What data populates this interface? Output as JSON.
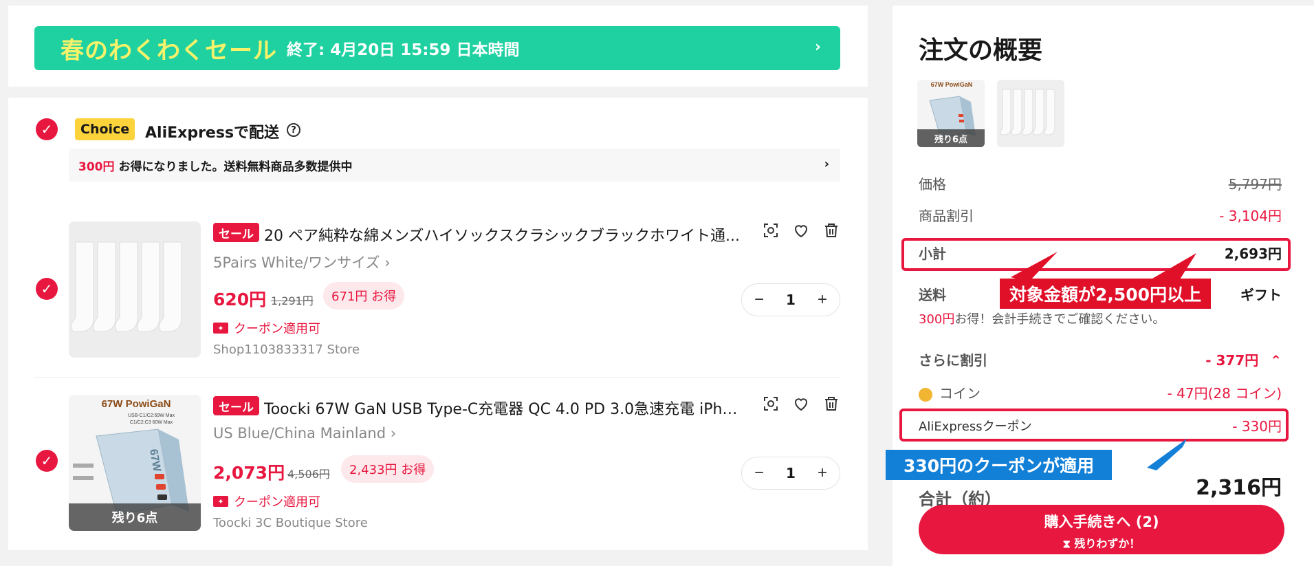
{
  "banner": {
    "title": "春のわくわくセール",
    "subtitle": "終了: 4月20日 15:59 日本時間",
    "chevron": "›"
  },
  "shipping": {
    "choice_badge": "Choice",
    "title": "AliExpressで配送",
    "help": "?",
    "savings_amount": "300円",
    "savings_text": "お得になりました。送料無料商品多数提供中",
    "chevron": "›"
  },
  "items": [
    {
      "sale_tag": "セール",
      "title": "20 ペア純粋な綿メンズハイソックスクラシックブラックホワイト通...",
      "variant": "5Pairs White/ワンサイズ ›",
      "price": "620円",
      "old_price": "1,291円",
      "save": "671円 お得",
      "coupon": "クーポン適用可",
      "store": "Shop1103833317 Store",
      "qty": "1"
    },
    {
      "sale_tag": "セール",
      "title": "Toocki 67W GaN USB Type-C充電器 QC 4.0 PD 3.0急速充電 iPhone...",
      "variant": "US Blue/China Mainland ›",
      "price": "2,073円",
      "old_price": "4,506円",
      "save": "2,433円 お得",
      "coupon": "クーポン適用可",
      "store": "Toocki 3C Boutique Store",
      "qty": "1",
      "image_brand": "67W PowiGaN",
      "image_spec1": "USB-C1/C2:69W Max",
      "image_spec2": "C1/C2:C3 60W Max",
      "image_device": "67W",
      "remaining": "残り6点"
    }
  ],
  "qty_controls": {
    "minus": "−",
    "plus": "+"
  },
  "summary": {
    "title": "注文の概要",
    "thumb_tag": "残り6点",
    "thumb_brand": "67W PowiGaN",
    "price_label": "価格",
    "price_value": "5,797円",
    "discount_label": "商品割引",
    "discount_value": "- 3,104円",
    "subtotal_label": "小計",
    "subtotal_value": "2,693円",
    "shipping_label": "送料",
    "shipping_value_tail": "ギフト",
    "shipping_note_red": "300円",
    "shipping_note": "お得！会計手続きでご確認ください。",
    "more_discount_label": "さらに割引",
    "more_discount_value": "- 377円",
    "more_discount_chevron": "⌃",
    "coin_label": "コイン",
    "coin_value": "- 47円(28 コイン)",
    "coupon_label": "AliExpressクーポン",
    "coupon_value": "- 330円",
    "total_label": "合計（約）",
    "total_value": "2,316円",
    "checkout_label": "購入手続きへ (2)",
    "checkout_sub": "⧗ 残りわずか！"
  },
  "annotations": {
    "red_callout": "対象金額が2,500円以上",
    "blue_callout": "330円のクーポンが適用"
  },
  "colors": {
    "accent": "#e8173f",
    "banner": "#1fd1a0",
    "banner_title": "#f7f26a",
    "choice": "#fcd33b",
    "callout_blue": "#1380d8"
  }
}
